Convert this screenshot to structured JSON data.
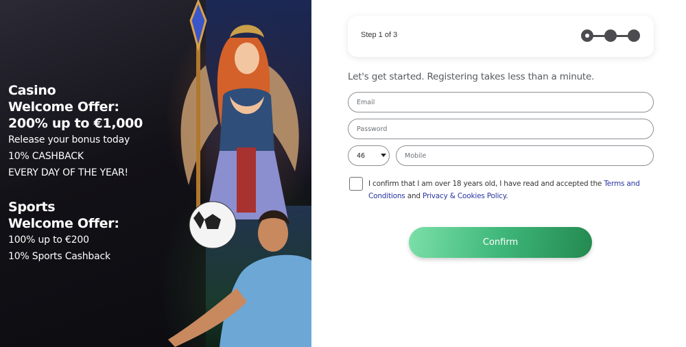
{
  "promo": {
    "casino": {
      "heading_line1": "Casino",
      "heading_line2": "Welcome Offer:",
      "heading_line3": "200% up to €1,000",
      "line1": "Release your bonus today",
      "line2": "10% CASHBACK",
      "line3": "EVERY DAY OF THE YEAR!"
    },
    "sports": {
      "heading_line1": "Sports",
      "heading_line2": "Welcome Offer:",
      "line1": "100% up to €200",
      "line2": "10% Sports Cashback"
    }
  },
  "stepper": {
    "label": "Step 1 of 3",
    "current_step": 1,
    "total_steps": 3
  },
  "form": {
    "intro": "Let's get started. Registering takes less than a minute.",
    "email_placeholder": "Email",
    "password_placeholder": "Password",
    "country_code": "46",
    "mobile_placeholder": "Mobile",
    "consent_prefix": "I confirm that I am over 18 years old, I have read and accepted the ",
    "terms_link": "Terms and Conditions",
    "consent_and": " and ",
    "privacy_link": "Privacy & Cookies Policy",
    "consent_suffix": ".",
    "confirm_label": "Confirm"
  },
  "colors": {
    "link": "#2733a0",
    "confirm_gradient_start": "#7be0a8",
    "confirm_gradient_end": "#23894f",
    "stepper_dot": "#4b4b50"
  },
  "icons": {
    "caret": "chevron-down-icon"
  }
}
